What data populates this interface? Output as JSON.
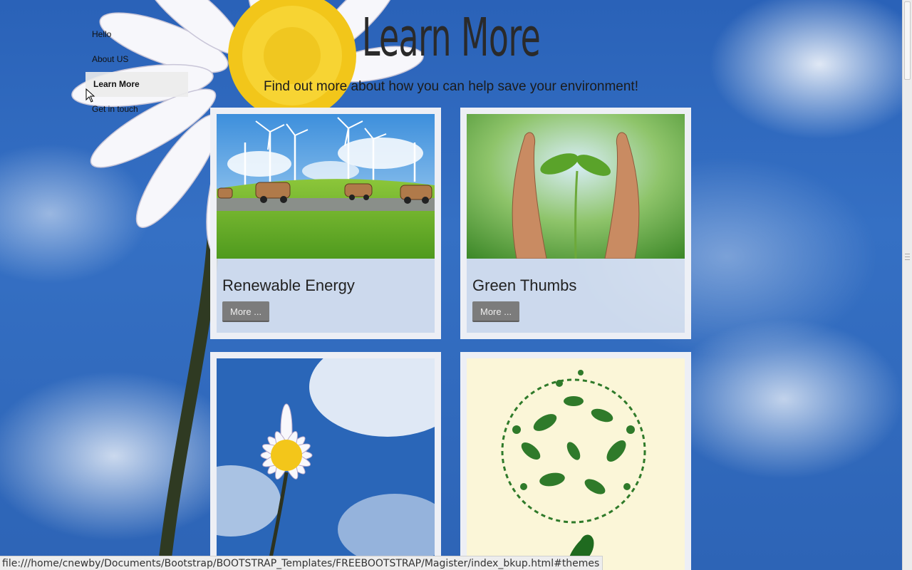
{
  "nav": {
    "items": [
      {
        "label": "Hello",
        "active": false
      },
      {
        "label": "About US",
        "active": false
      },
      {
        "label": "Learn More",
        "active": true
      },
      {
        "label": "Get in touch",
        "active": false
      }
    ]
  },
  "header": {
    "title": "Learn More",
    "subtitle": "Find out more about how you can help save your environment!"
  },
  "cards": [
    {
      "title": "Renewable Energy",
      "button": "More ...",
      "image": "wind-turbines-image"
    },
    {
      "title": "Green Thumbs",
      "button": "More ...",
      "image": "hands-seedling-image"
    },
    {
      "title": "",
      "button": "",
      "image": "daisy-sky-image"
    },
    {
      "title": "",
      "button": "",
      "image": "leafy-globe-image"
    }
  ],
  "status_bar": {
    "url": "file:///home/cnewby/Documents/Bootstrap/BOOTSTRAP_Templates/FREEBOOTSTRAP/Magister/index_bkup.html#themes"
  },
  "colors": {
    "sky": "#2d64b6",
    "card_bg": "#e1e8f2",
    "button": "#7c7c7c",
    "nav_active": "#ebebeb"
  }
}
